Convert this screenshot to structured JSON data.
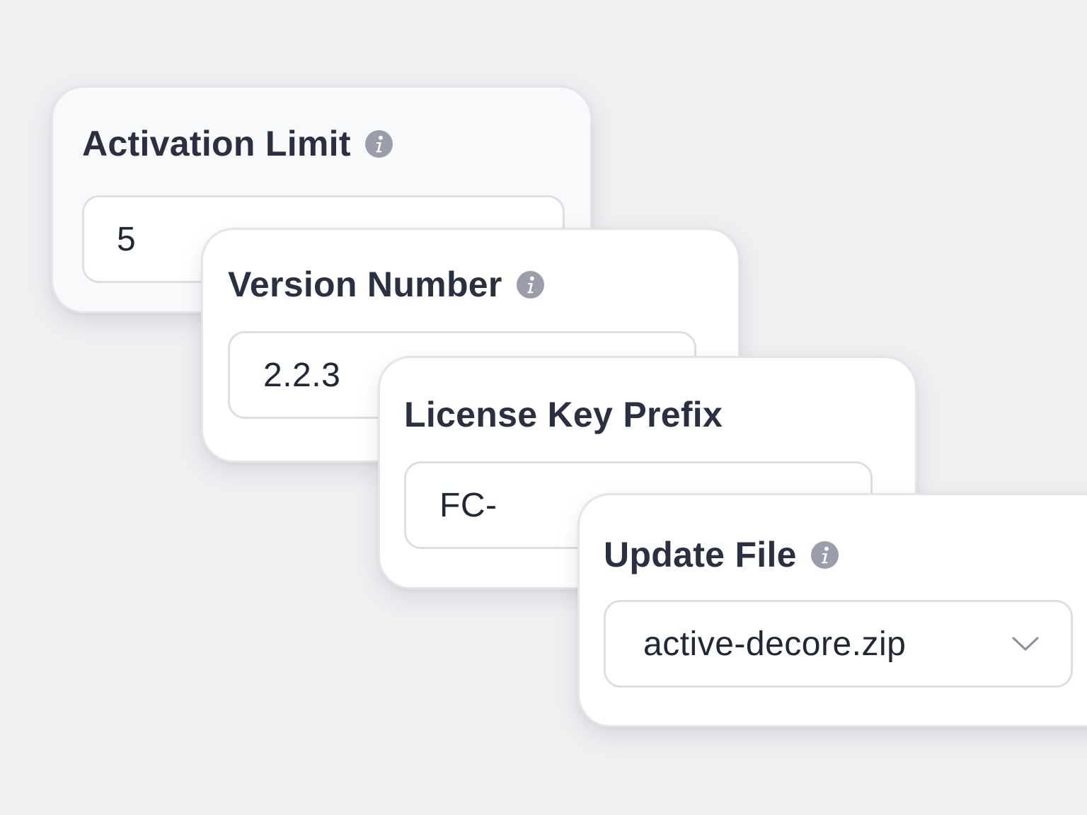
{
  "colors": {
    "background": "#eeeff1",
    "card": "#ffffff",
    "label_text": "#2a3042",
    "info_icon": "#9a9eaa"
  },
  "fields": {
    "activation_limit": {
      "label": "Activation Limit",
      "value": "5",
      "icon": "info-icon"
    },
    "version_number": {
      "label": "Version Number",
      "value": "2.2.3",
      "icon": "info-icon"
    },
    "license_key_prefix": {
      "label": "License Key Prefix",
      "value": "FC-"
    },
    "update_file": {
      "label": "Update File",
      "selected": "active-decore.zip",
      "icon": "info-icon",
      "dropdown_icon": "chevron-down-icon"
    }
  }
}
